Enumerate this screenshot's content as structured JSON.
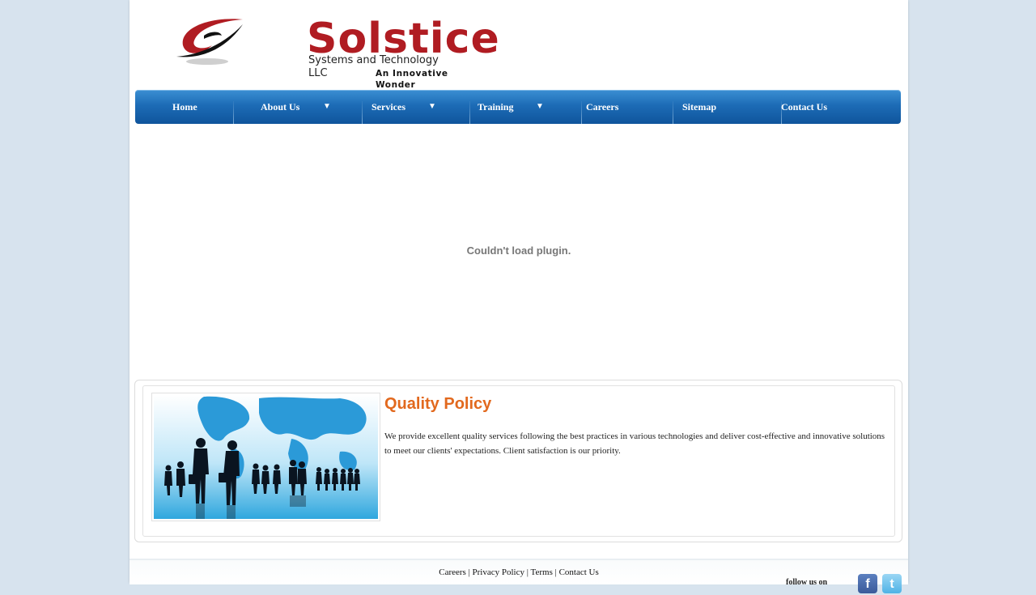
{
  "header": {
    "logo_name": "Solstice",
    "logo_subtitle": "Systems and Technology LLC",
    "logo_tagline": "An Innovative Wonder"
  },
  "nav": {
    "items": [
      {
        "label": "Home",
        "has_dropdown": false
      },
      {
        "label": "About Us",
        "has_dropdown": true
      },
      {
        "label": "Services",
        "has_dropdown": true
      },
      {
        "label": "Training",
        "has_dropdown": true
      },
      {
        "label": "Careers",
        "has_dropdown": false
      },
      {
        "label": "Sitemap",
        "has_dropdown": false
      },
      {
        "label": "Contact Us",
        "has_dropdown": false
      }
    ],
    "dropdown_glyph": "▼"
  },
  "plugin": {
    "message": "Couldn't load plugin."
  },
  "quality": {
    "title": "Quality Policy",
    "text": "We provide excellent quality services following the best practices in various technologies and deliver cost-effective and innovative solutions to meet our clients' expectations. Client satisfaction is our priority.",
    "image_icon": "business-people-world-map-image"
  },
  "footer": {
    "links": [
      "Careers",
      "Privacy Policy",
      "Terms",
      "Contact Us"
    ],
    "separator": "|",
    "follow_label": "follow us on",
    "social": [
      {
        "icon": "facebook-icon",
        "glyph": "f"
      },
      {
        "icon": "twitter-icon",
        "glyph": "t"
      }
    ]
  },
  "colors": {
    "brand_red": "#b01c22",
    "nav_blue": "#1d6cb6",
    "title_orange": "#e2691e",
    "page_bg": "#d7e3ee"
  }
}
